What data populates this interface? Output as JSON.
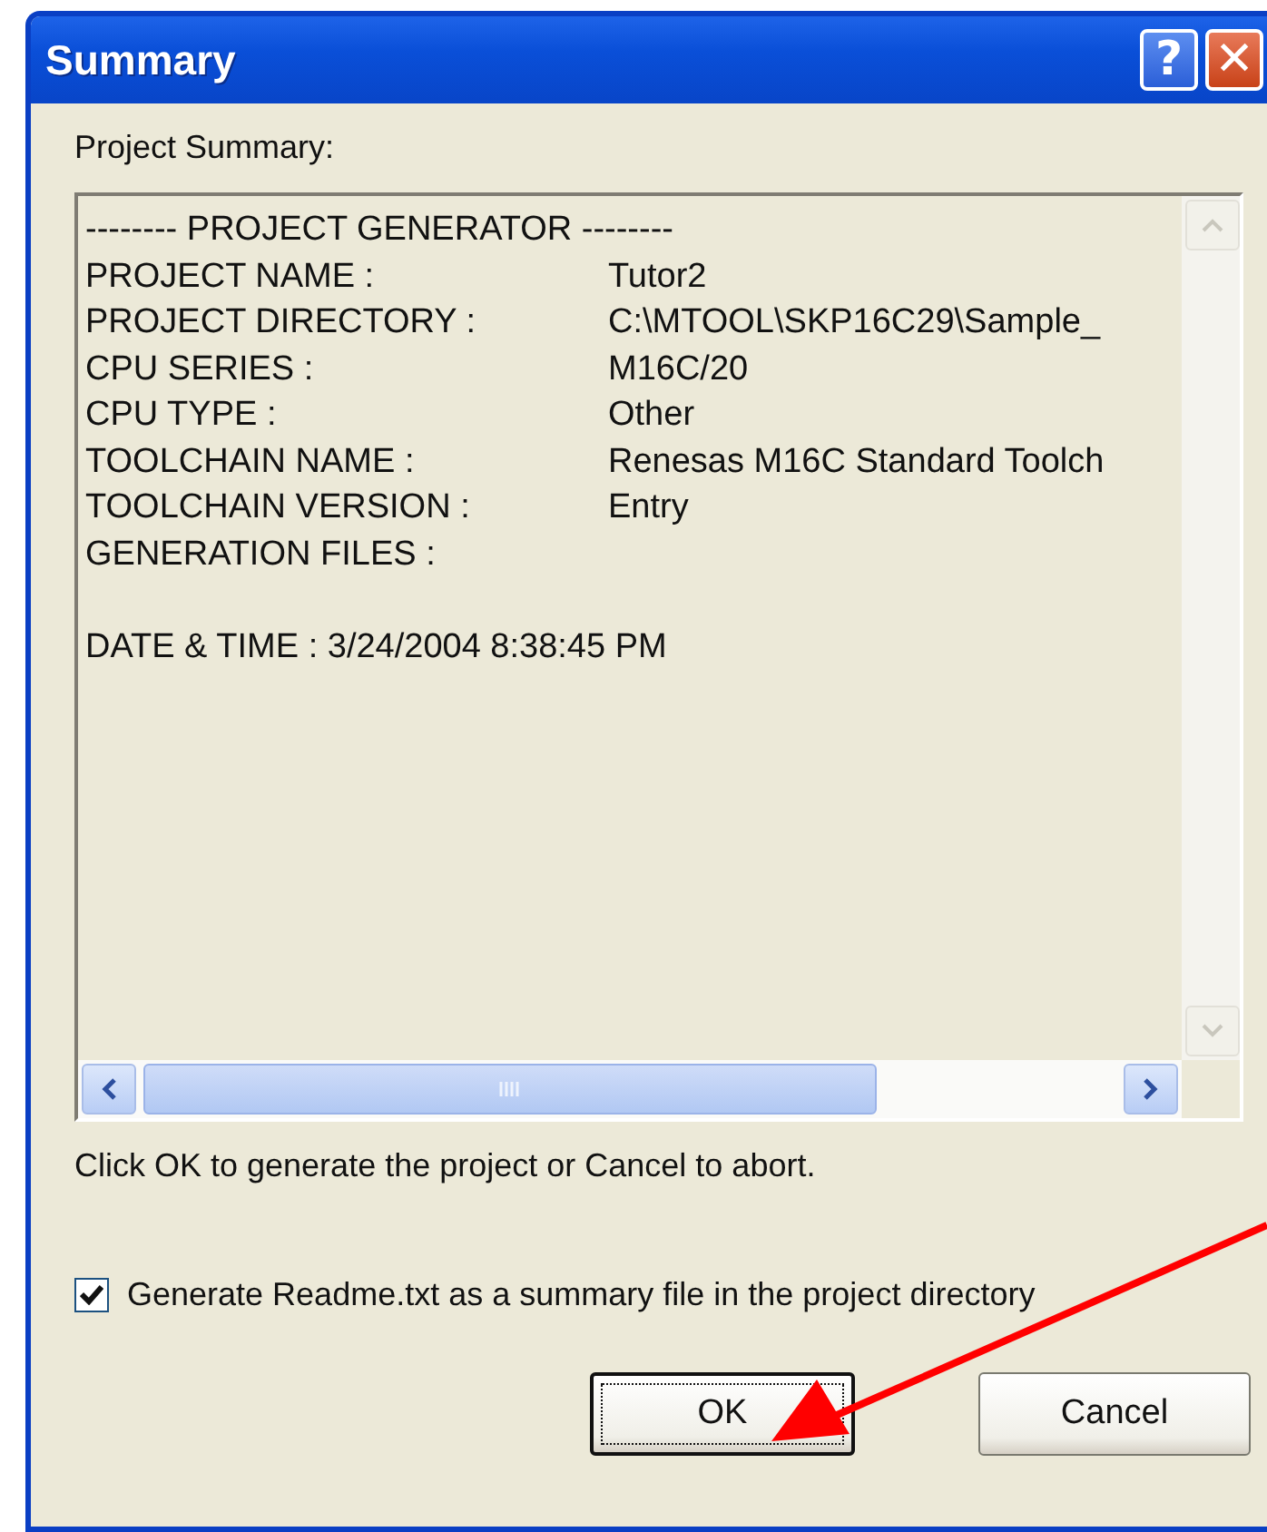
{
  "window": {
    "title": "Summary",
    "help_button": "?",
    "close_button": "✕"
  },
  "summary_label": "Project Summary:",
  "summary": {
    "header": "-------- PROJECT GENERATOR --------",
    "rows": [
      {
        "label": "PROJECT NAME :",
        "value": "Tutor2"
      },
      {
        "label": "PROJECT DIRECTORY :",
        "value": "C:\\MTOOL\\SKP16C29\\Sample_"
      },
      {
        "label": "CPU SERIES :",
        "value": "M16C/20"
      },
      {
        "label": "CPU TYPE :",
        "value": "Other"
      },
      {
        "label": "TOOLCHAIN NAME :",
        "value": "Renesas M16C Standard Toolch"
      },
      {
        "label": "TOOLCHAIN VERSION :",
        "value": "Entry"
      },
      {
        "label": "GENERATION FILES :"
      }
    ],
    "footer": "DATE & TIME : 3/24/2004 8:38:45 PM"
  },
  "instruction": "Click OK to generate the project or Cancel to abort.",
  "readme_checkbox": {
    "label": "Generate Readme.txt as a summary file in the project directory",
    "checked": true
  },
  "buttons": [
    {
      "label": "OK",
      "default": true
    },
    {
      "label": "Cancel",
      "default": false
    }
  ]
}
